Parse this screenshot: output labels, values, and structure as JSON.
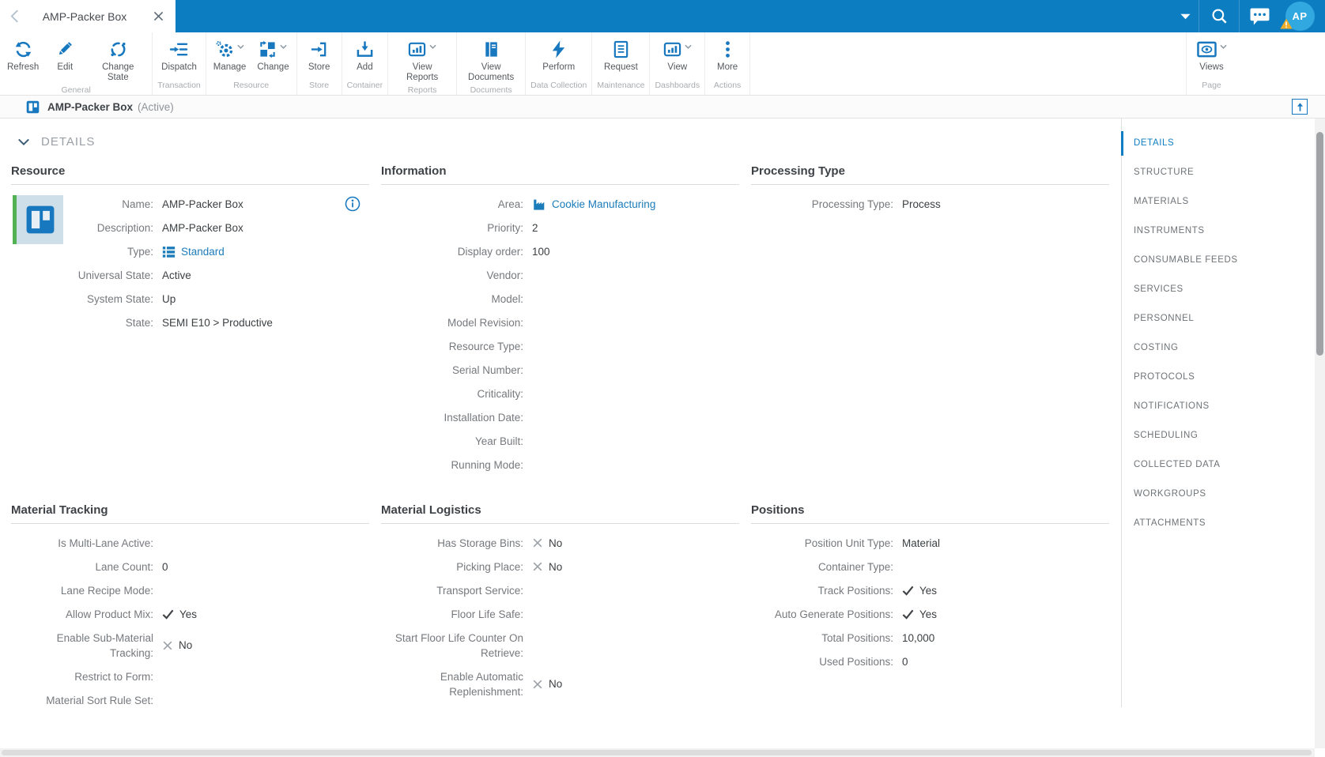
{
  "colors": {
    "topbar": "#0d7dc2",
    "icon_blue": "#1878bf",
    "link": "#1c7cba",
    "active_nav": "#0e7ec2",
    "avatar_bg": "#31a8e0",
    "warning": "#eead28",
    "thumb_green": "#52b153",
    "thumb_bg": "#cfdfe9"
  },
  "tab": {
    "title": "AMP-Packer Box"
  },
  "topbar": {
    "avatar_initials": "AP"
  },
  "ribbon": {
    "groups": [
      {
        "label": "General",
        "buttons": [
          {
            "label": "Refresh",
            "icon": "refresh"
          },
          {
            "label": "Edit",
            "icon": "edit"
          },
          {
            "label": "Change State",
            "icon": "change-state"
          }
        ]
      },
      {
        "label": "Transaction",
        "buttons": [
          {
            "label": "Dispatch",
            "icon": "dispatch"
          }
        ]
      },
      {
        "label": "Resource",
        "buttons": [
          {
            "label": "Manage",
            "icon": "manage",
            "caret": true
          },
          {
            "label": "Change",
            "icon": "change",
            "caret": true
          }
        ]
      },
      {
        "label": "Store",
        "buttons": [
          {
            "label": "Store",
            "icon": "store"
          }
        ]
      },
      {
        "label": "Container",
        "buttons": [
          {
            "label": "Add",
            "icon": "add"
          }
        ]
      },
      {
        "label": "Reports",
        "buttons": [
          {
            "label": "View Reports",
            "icon": "view-reports",
            "caret": true
          }
        ]
      },
      {
        "label": "Documents",
        "buttons": [
          {
            "label": "View Documents",
            "icon": "view-documents"
          }
        ]
      },
      {
        "label": "Data Collection",
        "buttons": [
          {
            "label": "Perform",
            "icon": "perform"
          }
        ]
      },
      {
        "label": "Maintenance",
        "buttons": [
          {
            "label": "Request",
            "icon": "request"
          }
        ]
      },
      {
        "label": "Dashboards",
        "buttons": [
          {
            "label": "View",
            "icon": "view-dashboards",
            "caret": true
          }
        ]
      },
      {
        "label": "Actions",
        "buttons": [
          {
            "label": "More",
            "icon": "more"
          }
        ]
      }
    ],
    "page_group": {
      "label": "Page",
      "buttons": [
        {
          "label": "Views",
          "icon": "views",
          "caret": true
        }
      ]
    }
  },
  "breadcrumb": {
    "title": "AMP-Packer Box",
    "status": "(Active)"
  },
  "details_section": {
    "title": "DETAILS"
  },
  "panels": {
    "resource": {
      "title": "Resource",
      "fields": [
        {
          "label": "Name:",
          "value": "AMP-Packer Box",
          "type": "text"
        },
        {
          "label": "Description:",
          "value": "AMP-Packer Box",
          "type": "text"
        },
        {
          "label": "Type:",
          "value": "Standard",
          "type": "link",
          "value_icon": "type-list"
        },
        {
          "label": "Universal State:",
          "value": "Active",
          "type": "text"
        },
        {
          "label": "System State:",
          "value": "Up",
          "type": "text"
        },
        {
          "label": "State:",
          "value": "SEMI E10 > Productive",
          "type": "text"
        }
      ]
    },
    "information": {
      "title": "Information",
      "fields": [
        {
          "label": "Area:",
          "value": "Cookie Manufacturing",
          "type": "link",
          "value_icon": "factory"
        },
        {
          "label": "Priority:",
          "value": "2",
          "type": "text"
        },
        {
          "label": "Display order:",
          "value": "100",
          "type": "text"
        },
        {
          "label": "Vendor:",
          "value": "",
          "type": "empty"
        },
        {
          "label": "Model:",
          "value": "",
          "type": "empty"
        },
        {
          "label": "Model Revision:",
          "value": "",
          "type": "empty"
        },
        {
          "label": "Resource Type:",
          "value": "",
          "type": "empty"
        },
        {
          "label": "Serial Number:",
          "value": "",
          "type": "empty"
        },
        {
          "label": "Criticality:",
          "value": "",
          "type": "empty"
        },
        {
          "label": "Installation Date:",
          "value": "",
          "type": "empty"
        },
        {
          "label": "Year Built:",
          "value": "",
          "type": "empty"
        },
        {
          "label": "Running Mode:",
          "value": "",
          "type": "empty"
        }
      ]
    },
    "processing_type": {
      "title": "Processing Type",
      "fields": [
        {
          "label": "Processing Type:",
          "value": "Process",
          "type": "text"
        }
      ]
    },
    "material_tracking": {
      "title": "Material Tracking",
      "fields": [
        {
          "label": "Is Multi-Lane Active:",
          "value": "",
          "type": "empty"
        },
        {
          "label": "Lane Count:",
          "value": "0",
          "type": "text"
        },
        {
          "label": "Lane Recipe Mode:",
          "value": "",
          "type": "empty"
        },
        {
          "label": "Allow Product Mix:",
          "value": "Yes",
          "type": "yes"
        },
        {
          "label": "Enable Sub-Material Tracking:",
          "value": "No",
          "type": "no"
        },
        {
          "label": "Restrict to Form:",
          "value": "",
          "type": "empty"
        },
        {
          "label": "Material Sort Rule Set:",
          "value": "",
          "type": "empty"
        }
      ]
    },
    "material_logistics": {
      "title": "Material Logistics",
      "fields": [
        {
          "label": "Has Storage Bins:",
          "value": "No",
          "type": "no"
        },
        {
          "label": "Picking Place:",
          "value": "No",
          "type": "no"
        },
        {
          "label": "Transport Service:",
          "value": "",
          "type": "empty"
        },
        {
          "label": "Floor Life Safe:",
          "value": "",
          "type": "empty"
        },
        {
          "label": "Start Floor Life Counter On Retrieve:",
          "value": "",
          "type": "empty"
        },
        {
          "label": "Enable Automatic Replenishment:",
          "value": "No",
          "type": "no"
        }
      ]
    },
    "positions": {
      "title": "Positions",
      "fields": [
        {
          "label": "Position Unit Type:",
          "value": "Material",
          "type": "text"
        },
        {
          "label": "Container Type:",
          "value": "",
          "type": "empty"
        },
        {
          "label": "Track Positions:",
          "value": "Yes",
          "type": "yes"
        },
        {
          "label": "Auto Generate Positions:",
          "value": "Yes",
          "type": "yes"
        },
        {
          "label": "Total Positions:",
          "value": "10,000",
          "type": "text"
        },
        {
          "label": "Used Positions:",
          "value": "0",
          "type": "text"
        }
      ]
    }
  },
  "sidebar": {
    "items": [
      {
        "label": "DETAILS",
        "active": true
      },
      {
        "label": "STRUCTURE"
      },
      {
        "label": "MATERIALS"
      },
      {
        "label": "INSTRUMENTS"
      },
      {
        "label": "CONSUMABLE FEEDS"
      },
      {
        "label": "SERVICES"
      },
      {
        "label": "PERSONNEL"
      },
      {
        "label": "COSTING"
      },
      {
        "label": "PROTOCOLS"
      },
      {
        "label": "NOTIFICATIONS"
      },
      {
        "label": "SCHEDULING"
      },
      {
        "label": "COLLECTED DATA"
      },
      {
        "label": "WORKGROUPS"
      },
      {
        "label": "ATTACHMENTS"
      }
    ]
  }
}
